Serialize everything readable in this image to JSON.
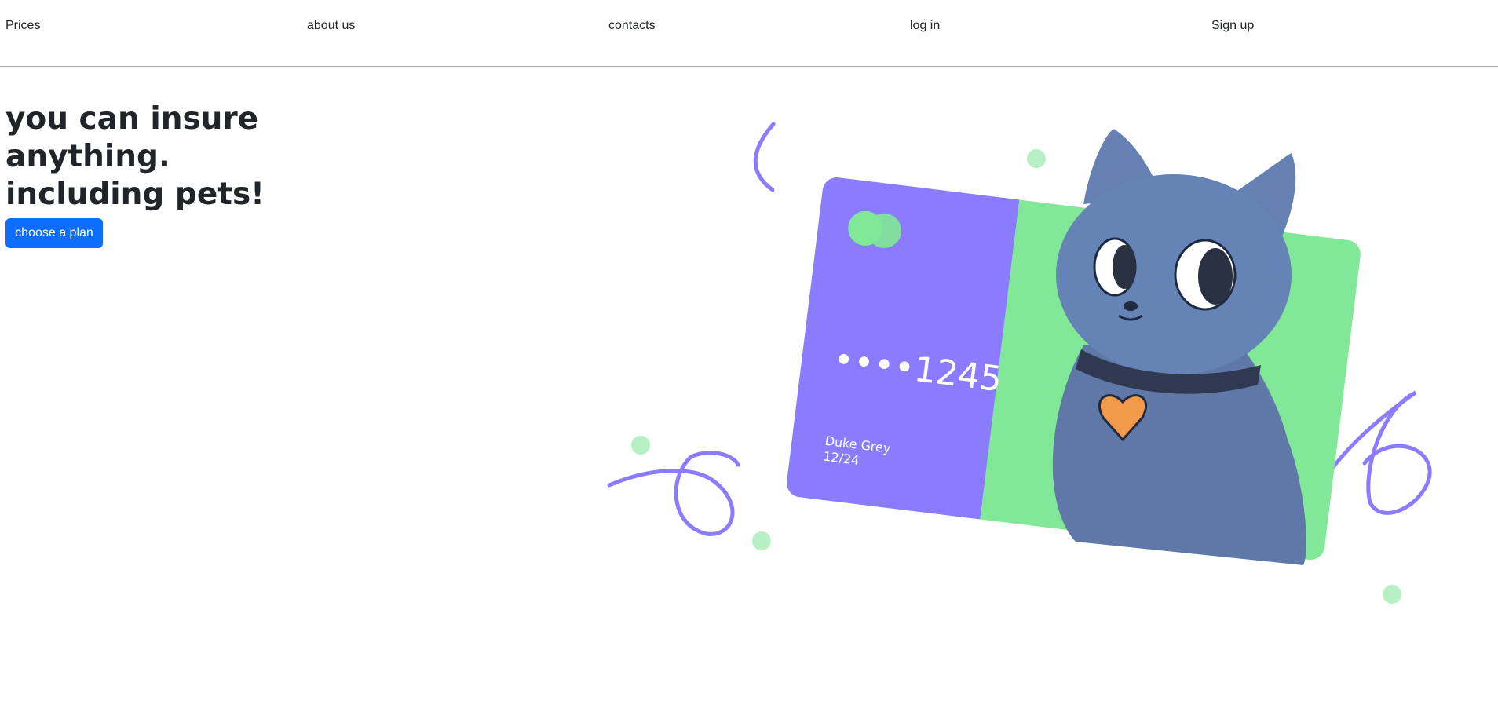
{
  "nav": {
    "items": [
      {
        "label": "Prices"
      },
      {
        "label": "about us"
      },
      {
        "label": "contacts"
      },
      {
        "label": "log in"
      },
      {
        "label": "Sign up"
      }
    ]
  },
  "hero": {
    "title_lines": [
      "you can insure",
      "anything.",
      "including pets!"
    ],
    "cta_label": "choose a plan"
  },
  "card": {
    "number": "••••1245",
    "holder": "Duke Grey",
    "expiry": "12/24"
  },
  "colors": {
    "accent_blue": "#0d6efd",
    "card_purple": "#8b7cff",
    "card_green": "#80e896",
    "cat_blue": "#5f78a8",
    "heart_orange": "#f39a4a"
  }
}
